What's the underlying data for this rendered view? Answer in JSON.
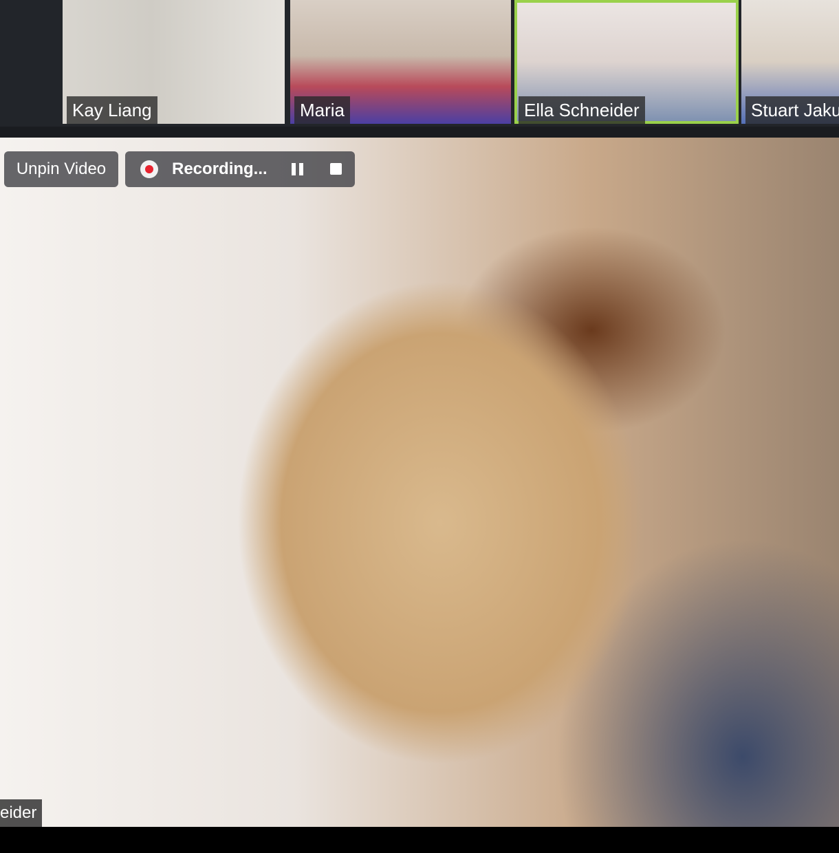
{
  "participants": [
    {
      "name": "Kay Liang"
    },
    {
      "name": "Maria"
    },
    {
      "name": "Ella Schneider",
      "active_speaker": true
    },
    {
      "name": "Stuart Jakub"
    }
  ],
  "controls": {
    "unpin_label": "Unpin Video",
    "recording_label": "Recording...",
    "pause_icon": "pause-icon",
    "stop_icon": "stop-icon",
    "record_icon": "record-icon"
  },
  "main_video": {
    "name_label": "eider"
  },
  "colors": {
    "active_speaker_border": "#9ad14b",
    "record_dot": "#e8232f"
  }
}
